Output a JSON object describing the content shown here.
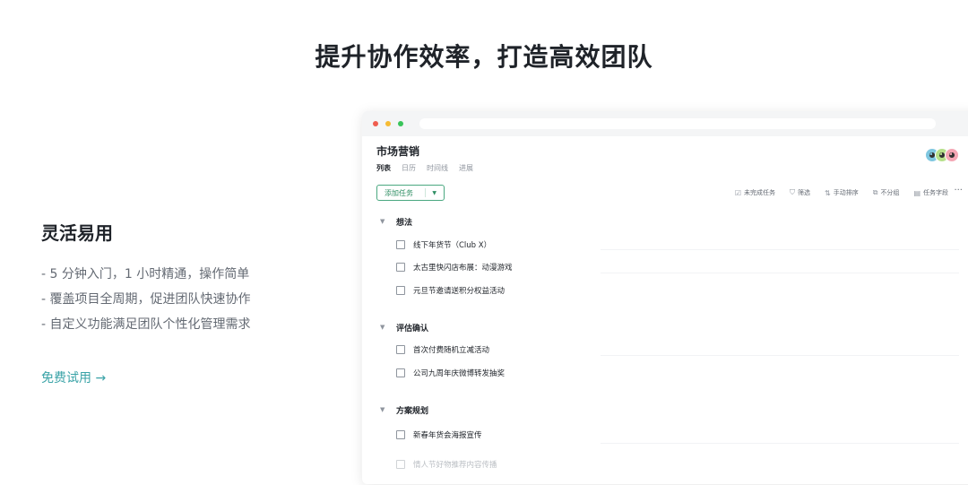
{
  "headline": "提升协作效率，打造高效团队",
  "feature": {
    "title": "灵活易用",
    "bullets": [
      "- 5 分钟入门，1 小时精通，操作简单",
      "- 覆盖项目全周期，促进团队快速协作",
      "- 自定义功能满足团队个性化管理需求"
    ],
    "cta": "免费试用 →"
  },
  "app": {
    "project_title": "市场营销",
    "views": [
      "列表",
      "日历",
      "时间线",
      "进展"
    ],
    "active_view": "列表",
    "toolbar": {
      "add_task": "添加任务",
      "filters": [
        {
          "icon": "checkbox-icon",
          "label": "未完成任务"
        },
        {
          "icon": "filter-icon",
          "label": "筛选"
        },
        {
          "icon": "sort-icon",
          "label": "手动排序"
        },
        {
          "icon": "group-icon",
          "label": "不分组"
        },
        {
          "icon": "fields-icon",
          "label": "任务字段"
        }
      ],
      "more": "···"
    },
    "groups": [
      {
        "name": "想法",
        "tasks": [
          "线下年货节（Club X）",
          "太古里快闪店布展：动漫游戏",
          "元旦节邀请送积分权益活动"
        ]
      },
      {
        "name": "评估确认",
        "tasks": [
          "首次付费随机立减活动",
          "公司九周年庆微博转发抽奖"
        ]
      },
      {
        "name": "方案规划",
        "tasks": [
          "新春年货会海报宣传",
          "情人节好物推荐内容传播"
        ]
      }
    ]
  },
  "colors": {
    "accent": "#3aa3a7",
    "button_green": "#2f8f64"
  }
}
